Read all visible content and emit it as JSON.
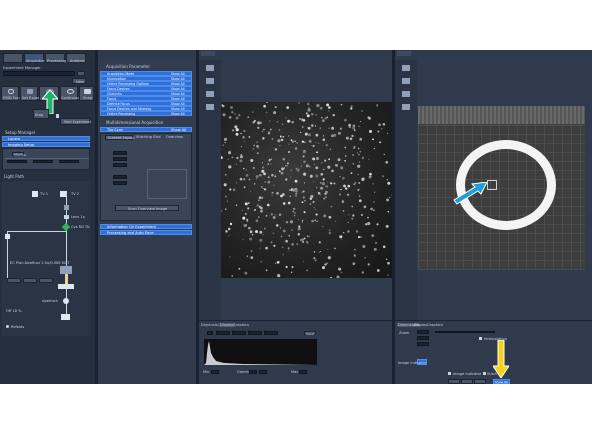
{
  "left_panel": {
    "tabs": [
      "",
      "Acquisition",
      "Processing",
      "Analysis"
    ],
    "experiment_manager_label": "Experiment Manager",
    "new_button": "New",
    "mode_buttons": [
      "FIND Focus",
      "Set Exposure",
      "Live",
      "Continuous",
      "Snap"
    ],
    "stop_button": "Stop",
    "start_experiment_button": "Start Experiment",
    "setup_manager_title": "Setup Manager",
    "setup_items": [
      "Locate",
      "Imaging Setup"
    ],
    "light_path_title": "Light Path",
    "light_path_labels": [
      "TV 1",
      "TV 2",
      "Lens 1x",
      "Cvs RD Tb",
      "EC Plan-Neofluar 2.5x/0.085 M27",
      "Aperture",
      "Off 18 %",
      "Refolds"
    ],
    "channel_button": "Channel",
    "bottom_buttons": [
      "",
      "",
      "",
      ""
    ]
  },
  "center_panel": {
    "acq_parameter_title": "Acquisition Parameter",
    "acq_parameter_items": [
      "Acquisition Mode",
      "Illumination",
      "Online Processing Options",
      "Focus Devices",
      "Channels",
      "Focus",
      "Definite Focus",
      "Focus Devices and Strategy",
      "Online Processing"
    ],
    "show_all_label": "Show All",
    "multidimensional_title": "Multidimensional Acquisition",
    "tile_scan_label": "Tile Scan",
    "tile_tabs": [
      "Current Layout",
      "Stitching Grid",
      "Overview"
    ],
    "overview_button": "Scan Overview Image",
    "bottom_items": [
      "Information On Experiment",
      "Processing and Auto Save"
    ]
  },
  "image_panel": {
    "bottom_tabs": [
      "Dimensions",
      "Display",
      "Graphics"
    ],
    "min_label": "Min",
    "max_label": "Max",
    "gamma_label": "Gamma",
    "reset_button": "Reset",
    "channel_label": "Channel"
  },
  "right_panel": {
    "bottom_tabs": [
      "Dimensions",
      "Display",
      "Graphics"
    ],
    "zoom_label": "Zoom",
    "interpolation_label": "Interpolation",
    "image_indicator_label": "Image Indicator",
    "stitch_label": "Stitch",
    "overview_button": "Show All"
  },
  "colors": {
    "app_bg": "#2f3a4d",
    "accent_blue": "#2f6fd6",
    "arrow_green": "#1fb36a",
    "arrow_blue": "#1f9fd8",
    "arrow_yellow": "#f5d21a"
  }
}
